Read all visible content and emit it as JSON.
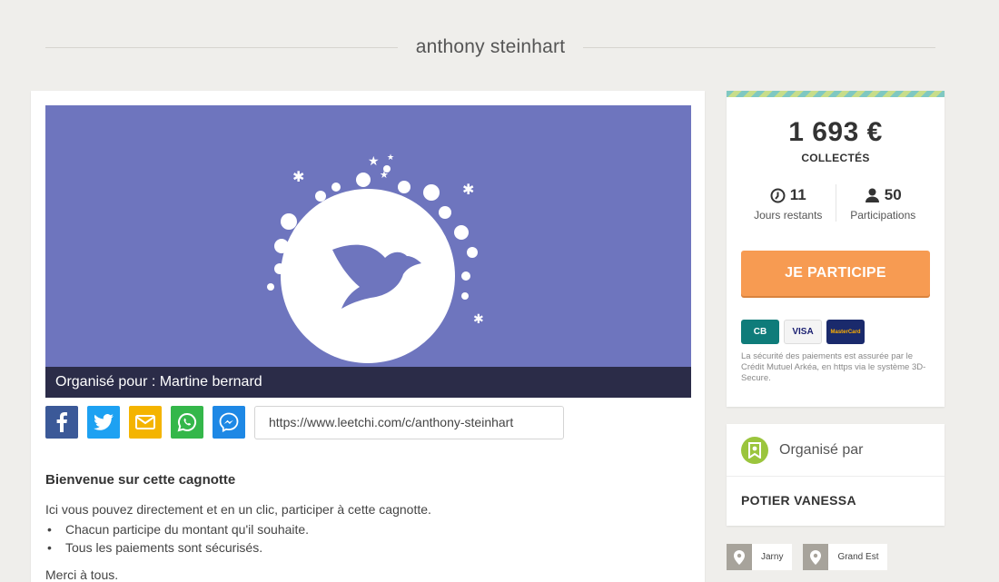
{
  "page": {
    "title": "anthony steinhart"
  },
  "banner": {
    "caption": "Organisé pour : Martine bernard"
  },
  "share": {
    "url": "https://www.leetchi.com/c/anthony-steinhart",
    "buttons": [
      {
        "name": "facebook",
        "color": "#3b5998"
      },
      {
        "name": "twitter",
        "color": "#1da1f2"
      },
      {
        "name": "email",
        "color": "#f4b400"
      },
      {
        "name": "whatsapp",
        "color": "#34b74a"
      },
      {
        "name": "messenger",
        "color": "#1e88e5"
      }
    ]
  },
  "description": {
    "heading": "Bienvenue sur cette cagnotte",
    "intro": "Ici vous pouvez directement et en un clic, participer à cette cagnotte.",
    "bullets": [
      "Chacun participe du montant qu'il souhaite.",
      "Tous les paiements sont sécurisés."
    ],
    "closing": "Merci à tous."
  },
  "stats": {
    "amount": "1 693 €",
    "amount_label": "COLLECTÉS",
    "days_value": "11",
    "days_label": "Jours restants",
    "participants_value": "50",
    "participants_label": "Participations",
    "cta_label": "JE PARTICIPE",
    "cards": [
      "CB",
      "VISA",
      "MasterCard"
    ],
    "secure_note": "La sécurité des paiements est assurée par le Crédit Mutuel Arkéa, en https via le système 3D-Secure."
  },
  "organizer": {
    "heading": "Organisé par",
    "name": "POTIER VANESSA"
  },
  "locations": [
    "Jarny",
    "Grand Est"
  ],
  "colors": {
    "banner": "#6e75be",
    "cta": "#f79b52",
    "organizer_badge": "#9bc53d"
  }
}
